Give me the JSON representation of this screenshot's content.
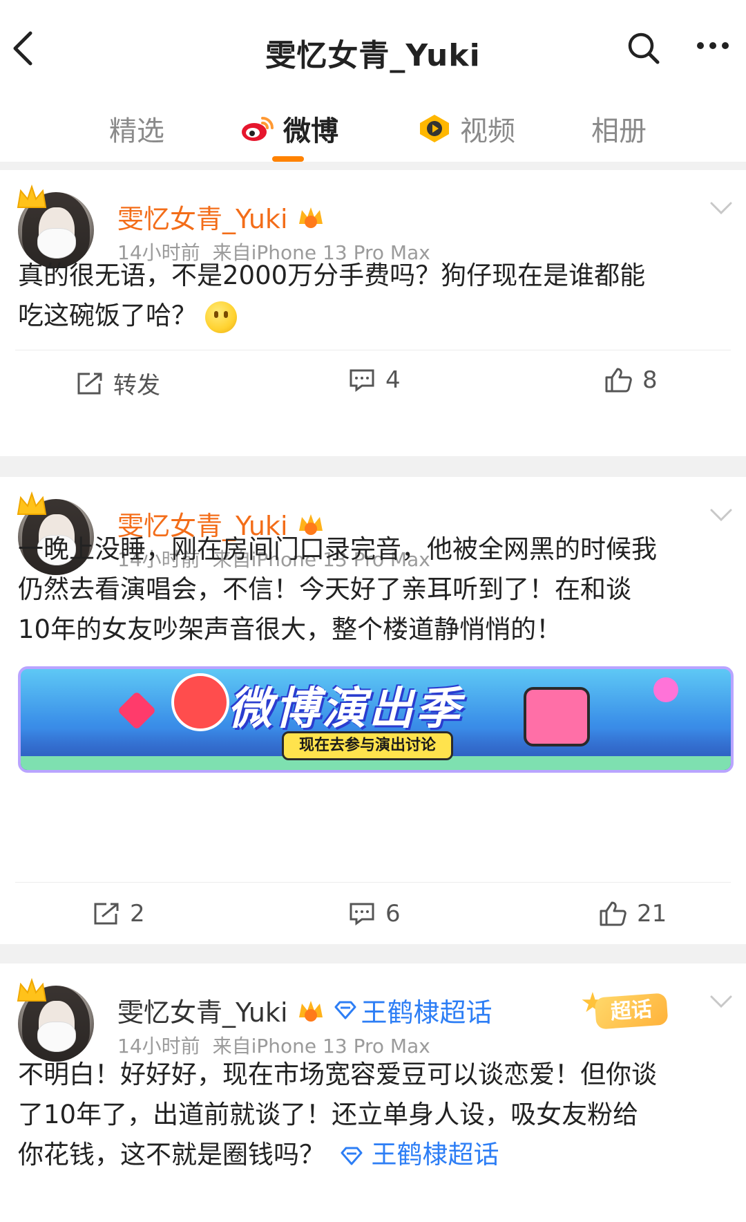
{
  "header": {
    "title": "雯忆女青_Yuki"
  },
  "tabs": [
    {
      "label": "精选",
      "active": false
    },
    {
      "label": "微博",
      "active": true
    },
    {
      "label": "视频",
      "active": false
    },
    {
      "label": "相册",
      "active": false
    }
  ],
  "posts": [
    {
      "author": "雯忆女青_Yuki",
      "time": "14小时前",
      "source": "来自iPhone 13 Pro Max",
      "text_line1": "真的很无语，不是2000万分手费吗？狗仔现在是谁都能",
      "text_line2": "吃这碗饭了哈？",
      "repost_label": "转发",
      "comments": "4",
      "likes": "8"
    },
    {
      "author": "雯忆女青_Yuki",
      "time": "14小时前",
      "source": "来自iPhone 13 Pro Max",
      "text_line1": "一晚上没睡，刚在房间门口录完音，他被全网黑的时候我",
      "text_line2": "仍然去看演唱会，不信！今天好了亲耳听到了！在和谈",
      "text_line3": "10年的女友吵架声音很大，整个楼道静悄悄的！",
      "banner_title": "微博演出季",
      "banner_cta": "现在去参与演出讨论",
      "reposts": "2",
      "comments": "6",
      "likes": "21"
    },
    {
      "author": "雯忆女青_Yuki",
      "topic": "王鹤棣超话",
      "chaohua_badge": "超话",
      "time": "14小时前",
      "source": "来自iPhone 13 Pro Max",
      "text_line1": "不明白！好好好，现在市场宽容爱豆可以谈恋爱！但你谈",
      "text_line2": "了10年了，出道前就谈了！还立单身人设，吸女友粉给",
      "text_line3": "你花钱，这不就是圈钱吗？",
      "inline_topic": "王鹤棣超话"
    }
  ],
  "colors": {
    "accent": "#ff8200",
    "author_name": "#f36d19",
    "topic_link": "#2d7ef5",
    "meta_text": "#9b9b9b"
  },
  "icons": [
    "back-icon",
    "search-icon",
    "more-icon",
    "weibo-logo-icon",
    "video-icon",
    "crown-icon",
    "vip-badge-icon",
    "chevron-down-icon",
    "repost-icon",
    "comment-icon",
    "like-icon",
    "supertopic-icon"
  ]
}
